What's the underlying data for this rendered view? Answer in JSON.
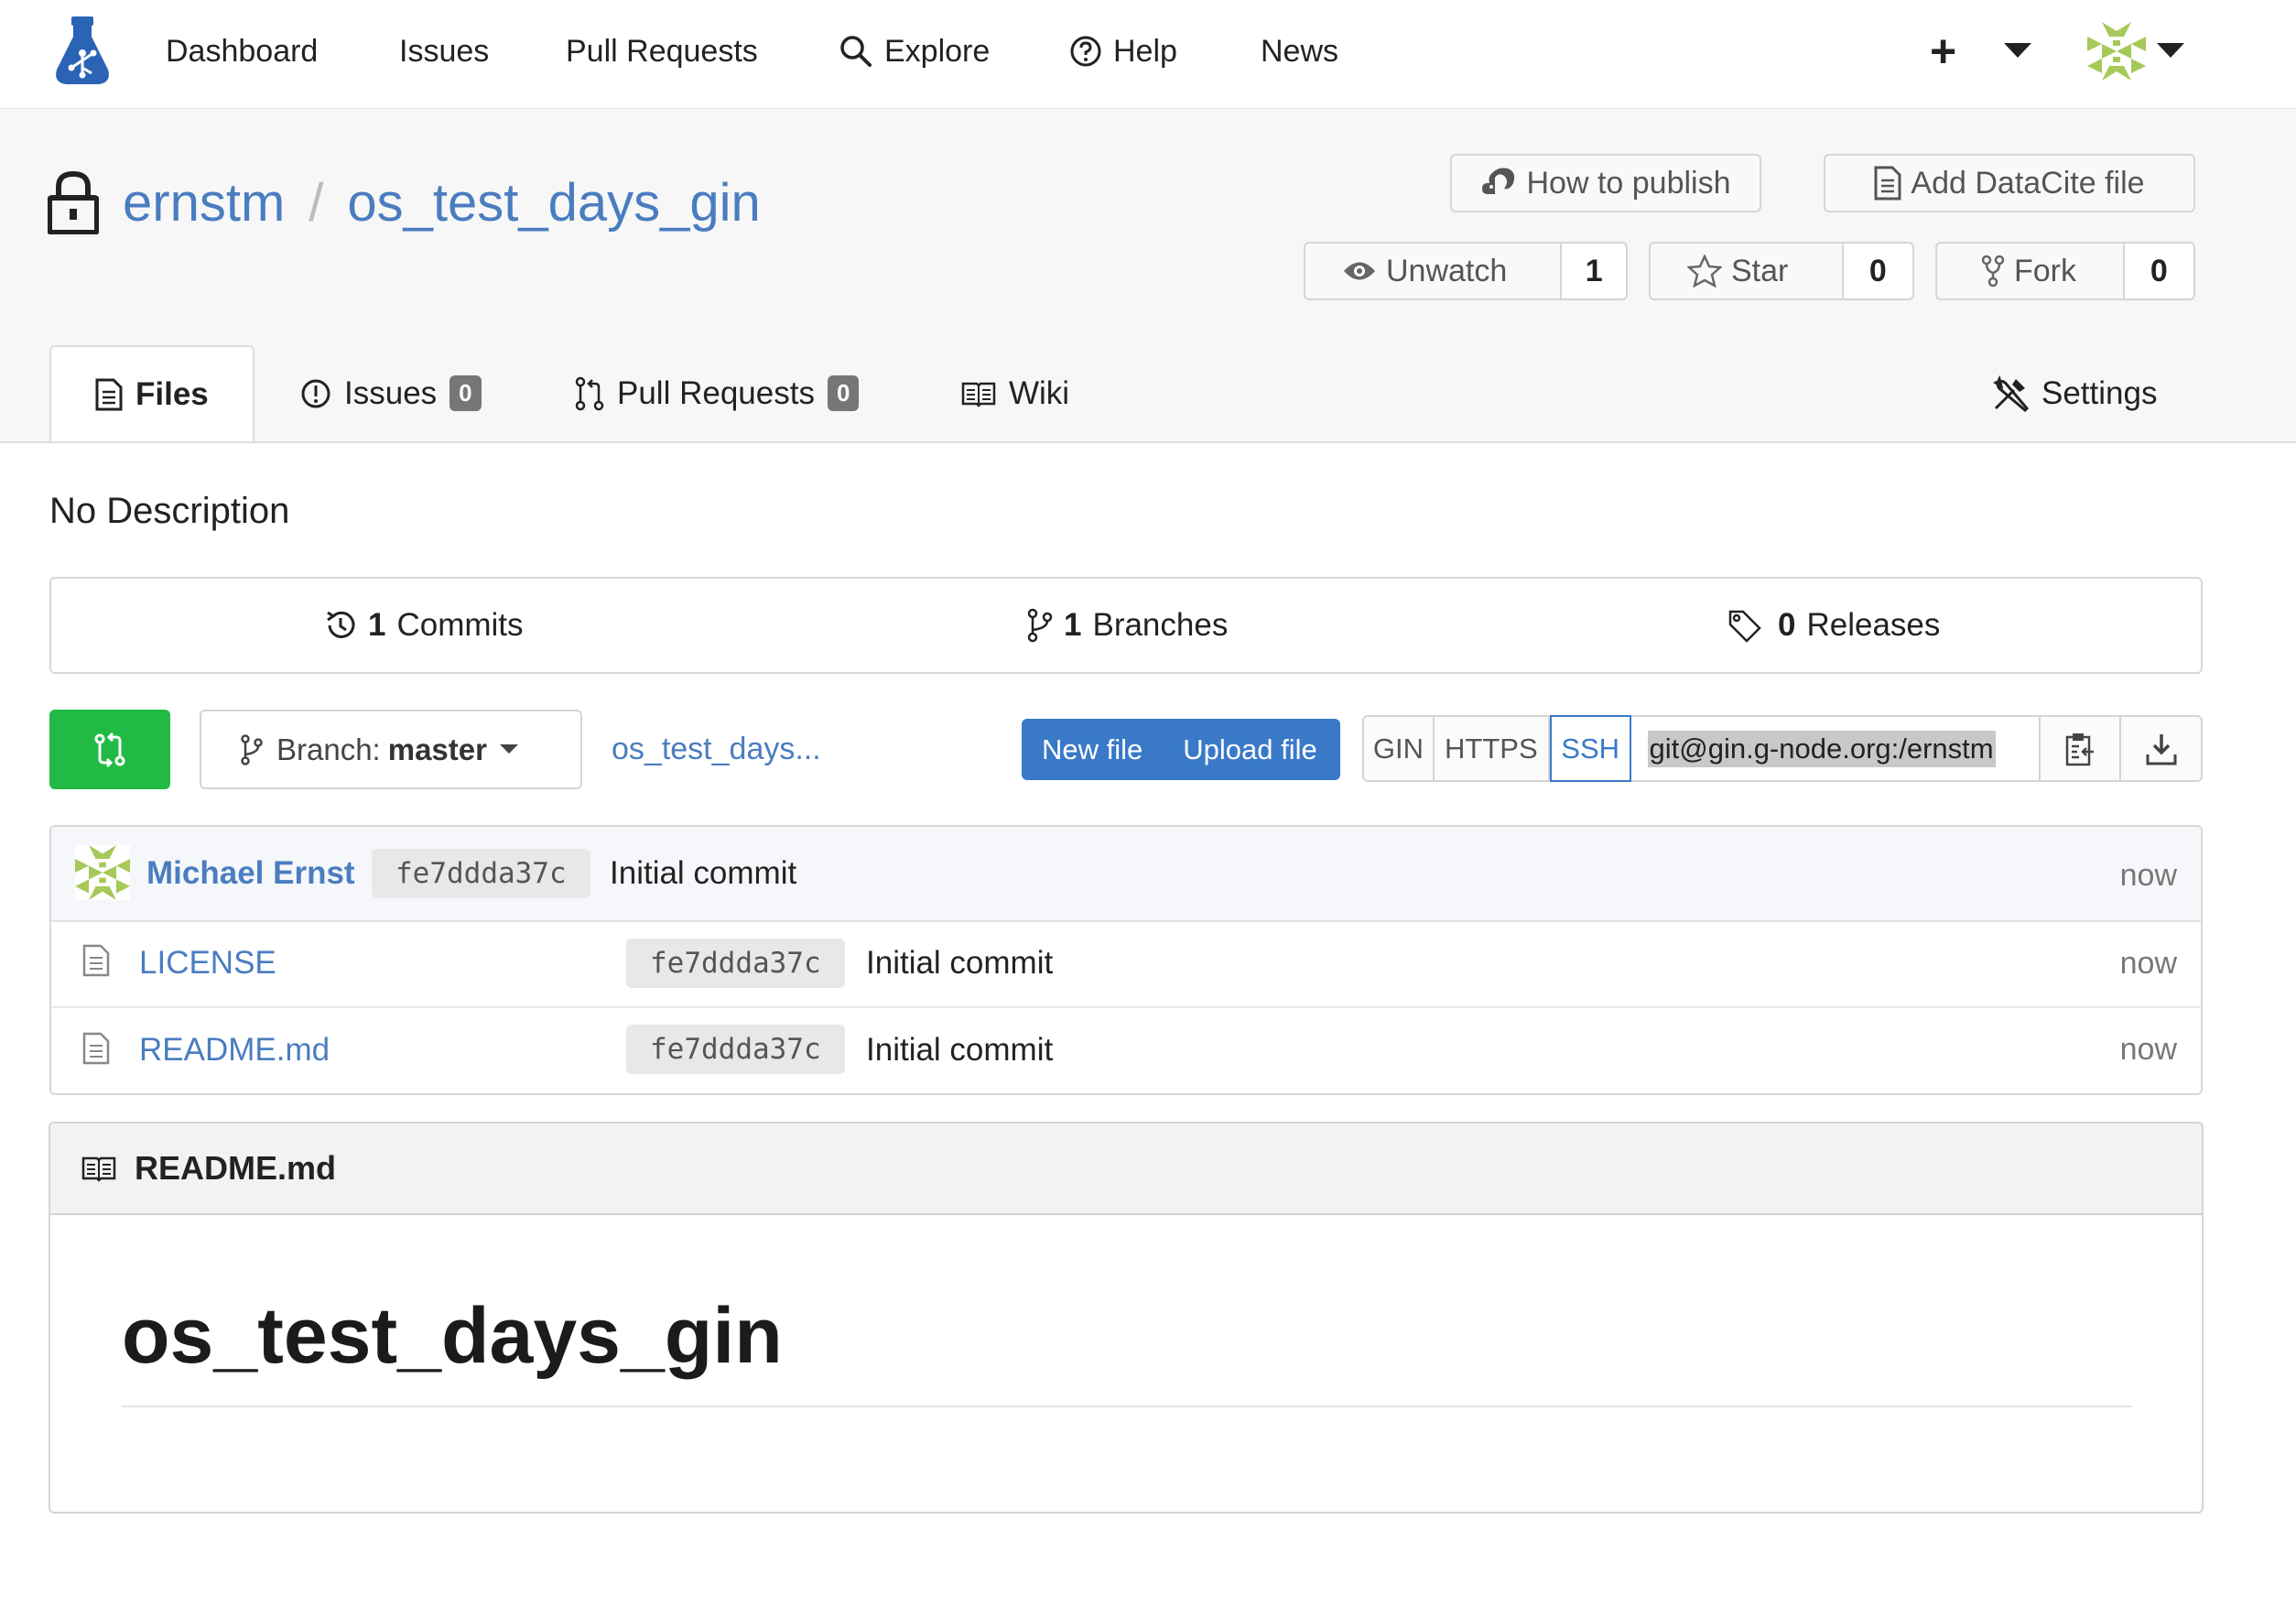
{
  "nav": {
    "items": [
      "Dashboard",
      "Issues",
      "Pull Requests",
      "Explore",
      "Help",
      "News"
    ],
    "plus_label": "+"
  },
  "repo": {
    "owner": "ernstm",
    "separator": "/",
    "name": "os_test_days_gin",
    "private": true,
    "description": "No Description"
  },
  "actions": {
    "how_to_publish": "How to publish",
    "add_datacite": "Add DataCite file",
    "unwatch": {
      "label": "Unwatch",
      "count": "1"
    },
    "star": {
      "label": "Star",
      "count": "0"
    },
    "fork": {
      "label": "Fork",
      "count": "0"
    }
  },
  "tabs": {
    "files": "Files",
    "issues": {
      "label": "Issues",
      "count": "0"
    },
    "pulls": {
      "label": "Pull Requests",
      "count": "0"
    },
    "wiki": "Wiki",
    "settings": "Settings"
  },
  "stats": {
    "commits": {
      "count": "1",
      "label": "Commits"
    },
    "branches": {
      "count": "1",
      "label": "Branches"
    },
    "releases": {
      "count": "0",
      "label": "Releases"
    }
  },
  "toolbar": {
    "branch_prefix": "Branch:",
    "branch_name": "master",
    "path": "os_test_days...",
    "new_file": "New file",
    "upload_file": "Upload file",
    "clone_protocols": [
      "GIN",
      "HTTPS",
      "SSH"
    ],
    "selected_protocol": "SSH",
    "clone_url": "git@gin.g-node.org:/ernstm"
  },
  "latest_commit": {
    "author": "Michael Ernst",
    "sha": "fe7ddda37c",
    "message": "Initial commit",
    "time": "now"
  },
  "files": [
    {
      "name": "LICENSE",
      "sha": "fe7ddda37c",
      "message": "Initial commit",
      "time": "now"
    },
    {
      "name": "README.md",
      "sha": "fe7ddda37c",
      "message": "Initial commit",
      "time": "now"
    }
  ],
  "readme": {
    "filename": "README.md",
    "heading": "os_test_days_gin"
  },
  "colors": {
    "accent": "#4a7dc0",
    "primary_button": "#3979c8",
    "sync_button": "#21ba45",
    "avatar_green": "#a6c95a"
  }
}
